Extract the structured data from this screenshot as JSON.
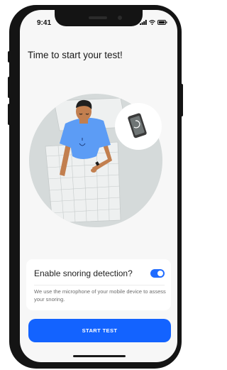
{
  "status_bar": {
    "time": "9:41"
  },
  "onboarding": {
    "title": "Time to start your test!"
  },
  "snoring_card": {
    "label": "Enable snoring detection?",
    "toggle_on": true,
    "description": "We use the microphone of your mobile device to assess your snoring."
  },
  "actions": {
    "start_label": "START TEST"
  },
  "colors": {
    "accent": "#1363ff",
    "background": "#f7f7f7",
    "illustration_circle": "#d5dada",
    "shirt": "#5c9cf5"
  },
  "icons": [
    "signal-icon",
    "wifi-icon",
    "battery-icon",
    "phone-icon"
  ]
}
